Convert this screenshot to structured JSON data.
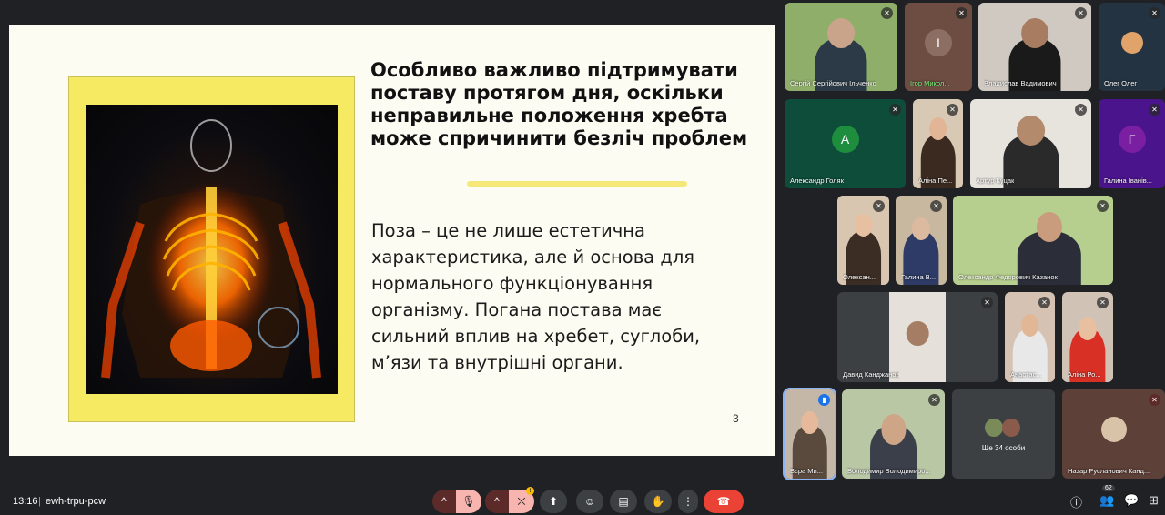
{
  "slide": {
    "title": "Особливо важливо підтримувати поставу протягом дня, оскільки неправильне положення хребта може спричинити безліч проблем",
    "body": "Поза – це не лише естетична характеристика, але й основа для нормального функціонування організму. Погана постава має сильний вплив на хребет, суглоби, м’язи та внутрішні органи.",
    "page_number": "3"
  },
  "participants": [
    {
      "name": "Сергій Сергійович Ільченко",
      "muted": true
    },
    {
      "name": "Ігор Микол...",
      "initial": "І",
      "avatar_color": "#8d6e63",
      "muted": true
    },
    {
      "name": "Владислав Вадимович",
      "muted": true
    },
    {
      "name": "Олег Олег",
      "muted": true
    },
    {
      "name": "Александр Голяк",
      "initial": "А",
      "avatar_color": "#1e8e3e",
      "muted": true
    },
    {
      "name": "Аліна Пе...",
      "muted": true
    },
    {
      "name": "Артур Куцак",
      "muted": true
    },
    {
      "name": "Галина Іванів...",
      "initial": "Г",
      "avatar_color": "#7b1fa2",
      "muted": true
    },
    {
      "name": "Олексан...",
      "muted": true
    },
    {
      "name": "Галина В...",
      "muted": true
    },
    {
      "name": "Олександр Федорович Казанок",
      "muted": true
    },
    {
      "name": "Давид Канджанов",
      "muted": true
    },
    {
      "name": "Анастас...",
      "muted": true
    },
    {
      "name": "Аліна Ро...",
      "muted": true
    },
    {
      "name": "Вєра Ми...",
      "muted": false
    },
    {
      "name": "Володимир Володимиро...",
      "muted": true
    },
    {
      "name": "Ще 34 особи",
      "muted": false
    },
    {
      "name": "Назар Русланович Канд...",
      "muted": true
    }
  ],
  "bottombar": {
    "time": "13:16",
    "meeting_code": "ewh-trpu-pcw",
    "people_count": "62",
    "camera_badge": "!"
  },
  "colors": {
    "end_call": "#ea4335",
    "accent_yellow": "#f6ea63",
    "muted_red": "#5c2b29"
  }
}
